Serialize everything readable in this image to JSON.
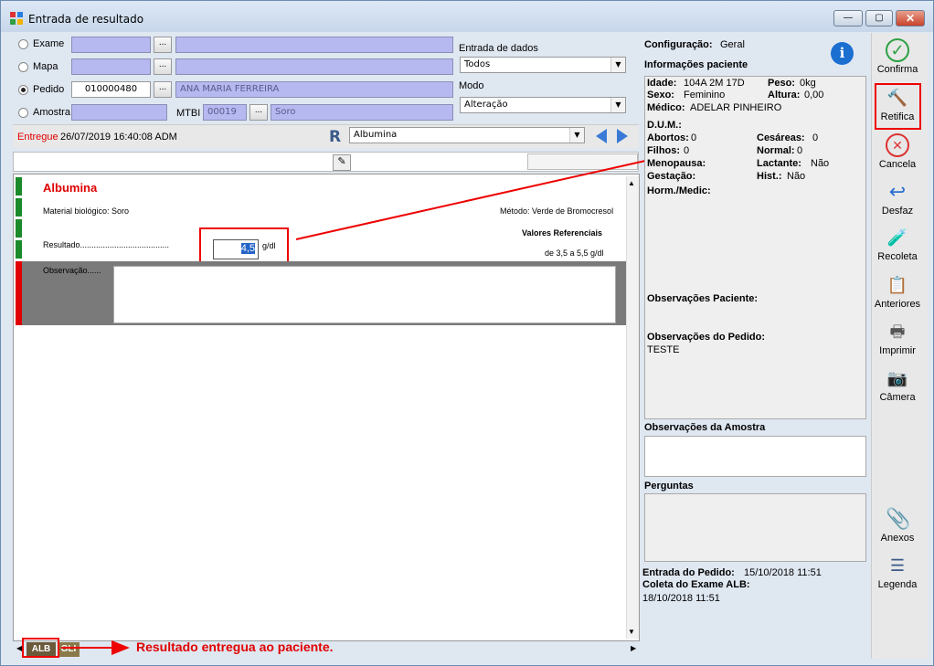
{
  "window": {
    "title": "Entrada de resultado",
    "min_label": "—",
    "max_label": "▢",
    "close_label": "✕"
  },
  "left": {
    "radios": [
      {
        "label": "Exame",
        "selected": false
      },
      {
        "label": "Mapa",
        "selected": false
      },
      {
        "label": "Pedido",
        "selected": true
      },
      {
        "label": "Amostra",
        "selected": false
      }
    ],
    "pedido_value": "010000480",
    "patient_name": "ANA MARIA FERREIRA",
    "mtbi_label": "MTBI",
    "mtbi_value": "00019",
    "sample_type": "Soro",
    "entrada_label": "Entrada de dados",
    "entrada_value": "Todos",
    "modo_label": "Modo",
    "modo_value": "Alteração",
    "status_label": "Entregue",
    "status_info": "26/07/2019  16:40:08  ADM",
    "exam_select": "Albumina",
    "dots": "..."
  },
  "exam": {
    "name": "Albumina",
    "material": "Material biológico: Soro",
    "metodo": "Método: Verde de Bromocresol",
    "ref_title": "Valores Referenciais",
    "ref_value": "de 3,5 a 5,5 g/dl",
    "result_label": "Resultado.......................................",
    "result_value": "4,5",
    "unit": "g/dl",
    "obs_label": "Observação......"
  },
  "bottom_tabs": [
    "ALB",
    "GLI"
  ],
  "annotation_text": "Resultado entregua ao paciente.",
  "patient": {
    "config_label": "Configuração:",
    "config_value": "Geral",
    "info_title": "Informações paciente",
    "idade_label": "Idade:",
    "idade": "104A 2M 17D",
    "peso_label": "Peso:",
    "peso": "0kg",
    "sexo_label": "Sexo:",
    "sexo": "Feminino",
    "altura_label": "Altura:",
    "altura": "0,00",
    "medico_label": "Médico:",
    "medico": "ADELAR PINHEIRO",
    "dum_label": "D.U.M.:",
    "abortos_label": "Abortos:",
    "abortos": "0",
    "cesareas_label": "Cesáreas:",
    "cesareas": "0",
    "filhos_label": "Filhos:",
    "filhos": "0",
    "normal_label": "Normal:",
    "normal": "0",
    "menopausa_label": "Menopausa:",
    "lactante_label": "Lactante:",
    "lactante": "Não",
    "gestacao_label": "Gestação:",
    "hist_label": "Hist.:",
    "hist": "Não",
    "hormedic_label": "Horm./Medic:",
    "obs_paciente_label": "Observações Paciente:",
    "obs_pedido_label": "Observações do Pedido:",
    "obs_pedido": "TESTE",
    "obs_amostra_label": "Observações da Amostra",
    "perguntas_label": "Perguntas",
    "entrada_pedido_label": "Entrada do Pedido:",
    "entrada_pedido": "15/10/2018 11:51",
    "coleta_label": "Coleta do Exame ALB:",
    "coleta": "18/10/2018 11:51"
  },
  "actions": {
    "confirma": "Confirma",
    "retifica": "Retifica",
    "cancela": "Cancela",
    "desfaz": "Desfaz",
    "recoleta": "Recoleta",
    "anteriores": "Anteriores",
    "imprimir": "Imprimir",
    "camera": "Câmera",
    "anexos": "Anexos",
    "legenda": "Legenda"
  },
  "colors": {
    "field": "#b6b8f0",
    "accent_red": "#e00000",
    "green_bar": "#1a8a2a"
  }
}
